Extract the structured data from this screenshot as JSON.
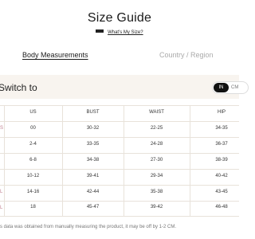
{
  "header": {
    "title": "Size Guide",
    "whats_my_size_label": "What's My Size?"
  },
  "tabs": [
    {
      "label": "Body Measurements",
      "active": true
    },
    {
      "label": "Country / Region",
      "active": false
    }
  ],
  "switch": {
    "label": "Switch to",
    "units": [
      "IN",
      "CM"
    ],
    "selected": "IN"
  },
  "table": {
    "headers": [
      "US",
      "BUST",
      "WAIST",
      "HIP"
    ],
    "first_col_ticks": [
      "S",
      "",
      "",
      "",
      "L",
      "L"
    ],
    "rows": [
      [
        "00",
        "30-32",
        "22-25",
        "34-35"
      ],
      [
        "2-4",
        "33-35",
        "24-28",
        "36-37"
      ],
      [
        "6-8",
        "34-38",
        "27-30",
        "38-39"
      ],
      [
        "10-12",
        "39-41",
        "29-34",
        "40-42"
      ],
      [
        "14-16",
        "42-44",
        "35-38",
        "43-45"
      ],
      [
        "18",
        "45-47",
        "39-42",
        "46-48"
      ]
    ]
  },
  "footnote": "s data was obtained from manually measuring the product, it may be off by 1-2 CM.",
  "colors": {
    "band": "#f8f4ef",
    "toggle_active": "#111111",
    "inactive_text": "#aaaaaa"
  }
}
